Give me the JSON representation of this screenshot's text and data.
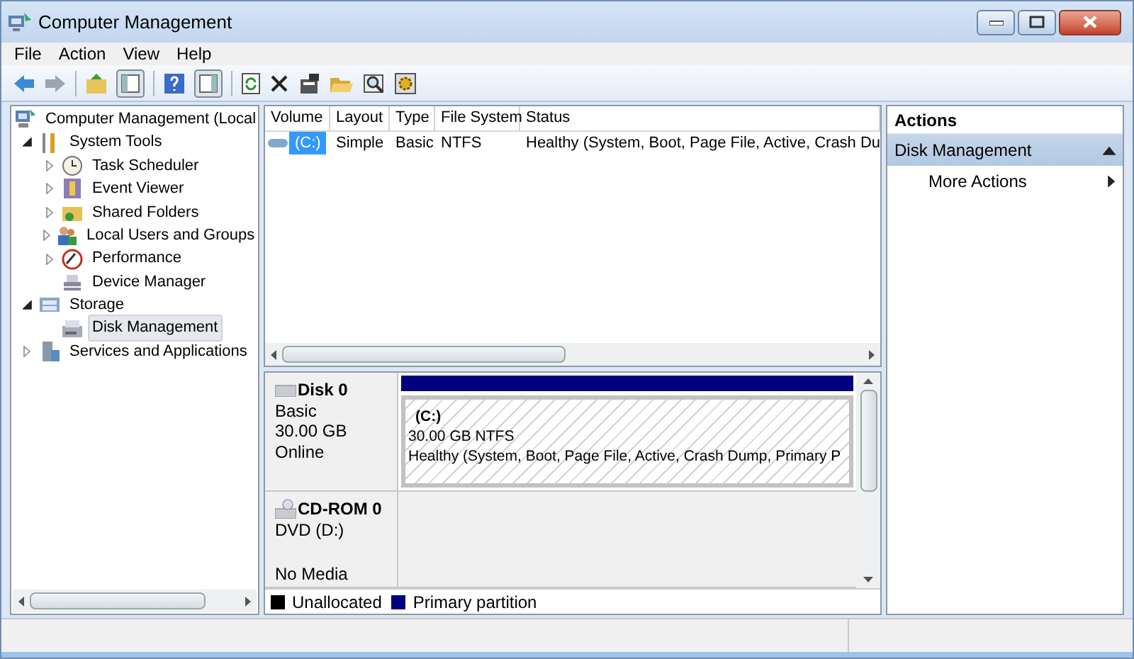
{
  "window": {
    "title": "Computer Management"
  },
  "menu": [
    "File",
    "Action",
    "View",
    "Help"
  ],
  "tree": [
    {
      "label": "Computer Management (Local",
      "selected": false,
      "children": [
        {
          "label": "System Tools",
          "expanded": true,
          "selected": false,
          "children": [
            {
              "label": "Task Scheduler",
              "expanded": false,
              "selected": false
            },
            {
              "label": "Event Viewer",
              "expanded": false,
              "selected": false
            },
            {
              "label": "Shared Folders",
              "expanded": false,
              "selected": false
            },
            {
              "label": "Local Users and Groups",
              "expanded": false,
              "selected": false
            },
            {
              "label": "Performance",
              "expanded": false,
              "selected": false
            },
            {
              "label": "Device Manager",
              "selected": false
            }
          ]
        },
        {
          "label": "Storage",
          "expanded": true,
          "selected": false,
          "children": [
            {
              "label": "Disk Management",
              "selected": true
            }
          ]
        },
        {
          "label": "Services and Applications",
          "expanded": false,
          "selected": false
        }
      ]
    }
  ],
  "volumes": {
    "columns": [
      "Volume",
      "Layout",
      "Type",
      "File System",
      "Status"
    ],
    "rows": [
      {
        "selected": true,
        "cells": [
          "(C:)",
          "Simple",
          "Basic",
          "NTFS",
          "Healthy (System, Boot, Page File, Active, Crash Du"
        ]
      }
    ]
  },
  "disks": [
    {
      "kind": "disk",
      "name": "Disk 0",
      "details": [
        "Basic",
        "30.00 GB",
        "Online"
      ],
      "partitions": [
        {
          "label": "(C:)",
          "size": "30.00 GB NTFS",
          "status": "Healthy (System, Boot, Page File, Active, Crash Dump, Primary P",
          "color": "#000080"
        }
      ]
    },
    {
      "kind": "cdrom",
      "name": "CD-ROM 0",
      "details": [
        "DVD (D:)",
        "No Media"
      ]
    }
  ],
  "legend": [
    {
      "label": "Unallocated",
      "color": "#000000"
    },
    {
      "label": "Primary partition",
      "color": "#000080"
    }
  ],
  "actions": {
    "header": "Actions",
    "section": {
      "title": "Disk Management",
      "expanded": true
    },
    "items": [
      "More Actions"
    ]
  }
}
